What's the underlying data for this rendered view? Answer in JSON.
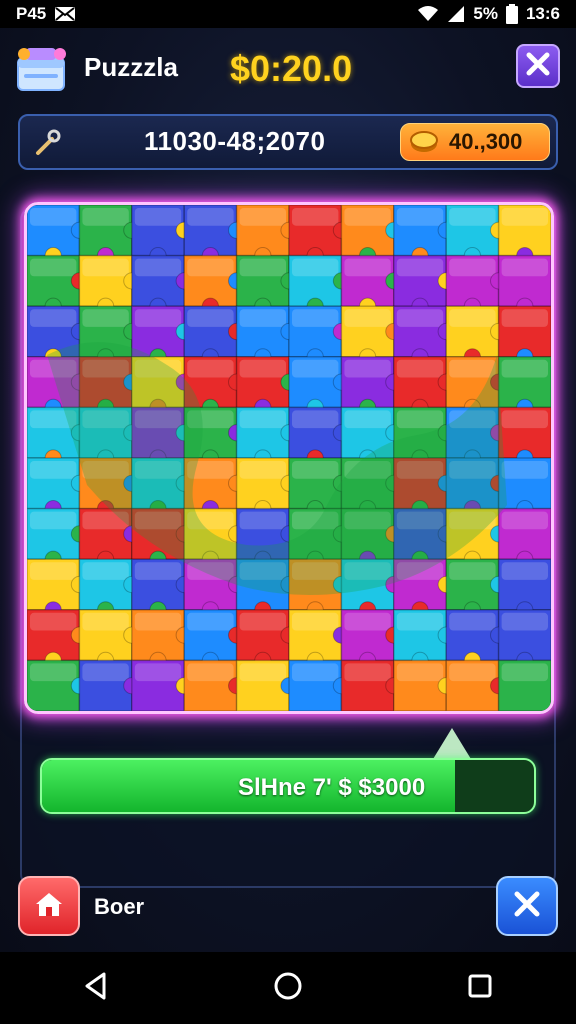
{
  "status_bar": {
    "left_text": "P45",
    "battery_text": "5%",
    "time": "13:6",
    "icons": [
      "mail-icon",
      "wifi-icon",
      "signal-icon",
      "battery-icon"
    ]
  },
  "header": {
    "app_title": "Puzzzla",
    "timer": "$0:20.0",
    "close_icon": "close-icon"
  },
  "info_bar": {
    "tool_icon": "wrench-icon",
    "code_text": "11030-48;2070",
    "coin_icon": "coin-icon",
    "coin_value": "40.,300"
  },
  "board": {
    "rows": 10,
    "cols": 10,
    "piece_colors": [
      "#e82a2a",
      "#ff8a1c",
      "#ffd11f",
      "#2bb34a",
      "#1e8cff",
      "#3b4fe0",
      "#8a2ce0",
      "#c02ad0",
      "#1ec6e6"
    ],
    "frame_color": "#ff5cf2"
  },
  "progress": {
    "label": "SlHne 7' $ $3000",
    "fill_percent": 84,
    "accent": "#13b52d"
  },
  "bottom": {
    "home_icon": "home-icon",
    "home_label": "Boer",
    "close_icon": "close-icon"
  },
  "navbar": {
    "buttons": [
      "back-icon",
      "home-circle-icon",
      "recents-icon"
    ]
  }
}
